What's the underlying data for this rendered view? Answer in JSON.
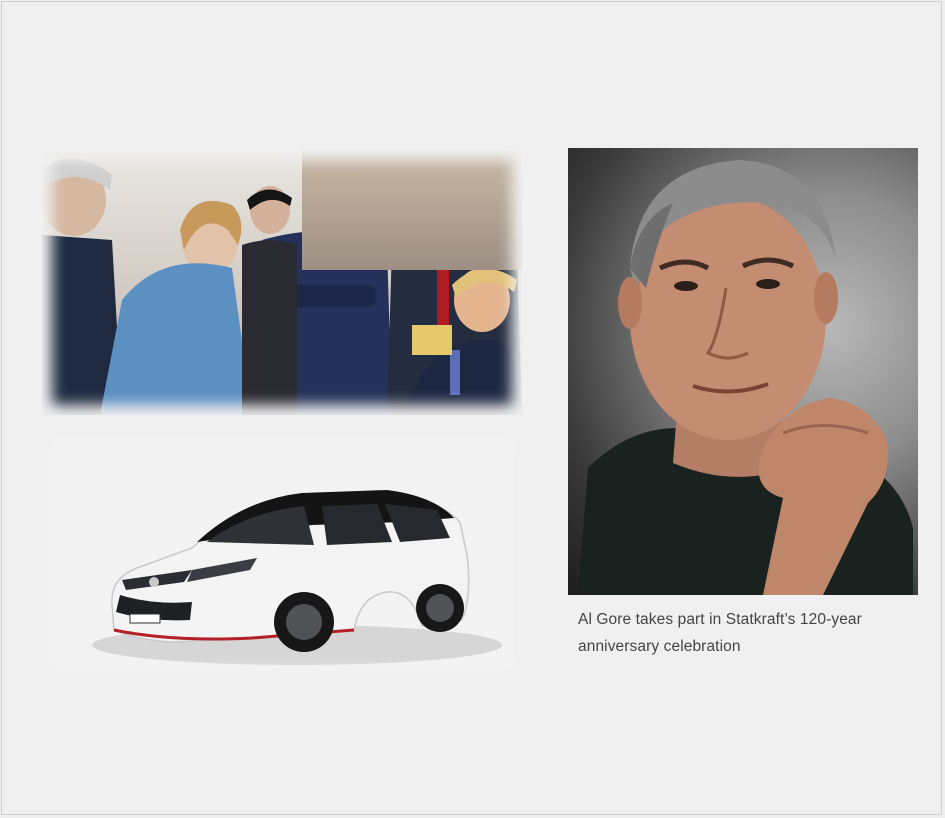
{
  "caption": "Al Gore takes part in Statkraft’s 120-year anniversary celebration",
  "images": {
    "group_photo": "group-of-leaders-photo",
    "car_photo": "white-hatchback-car-photo",
    "portrait_photo": "man-portrait-photo"
  },
  "colors": {
    "background": "#f0f0f0",
    "caption_text": "#444444"
  }
}
